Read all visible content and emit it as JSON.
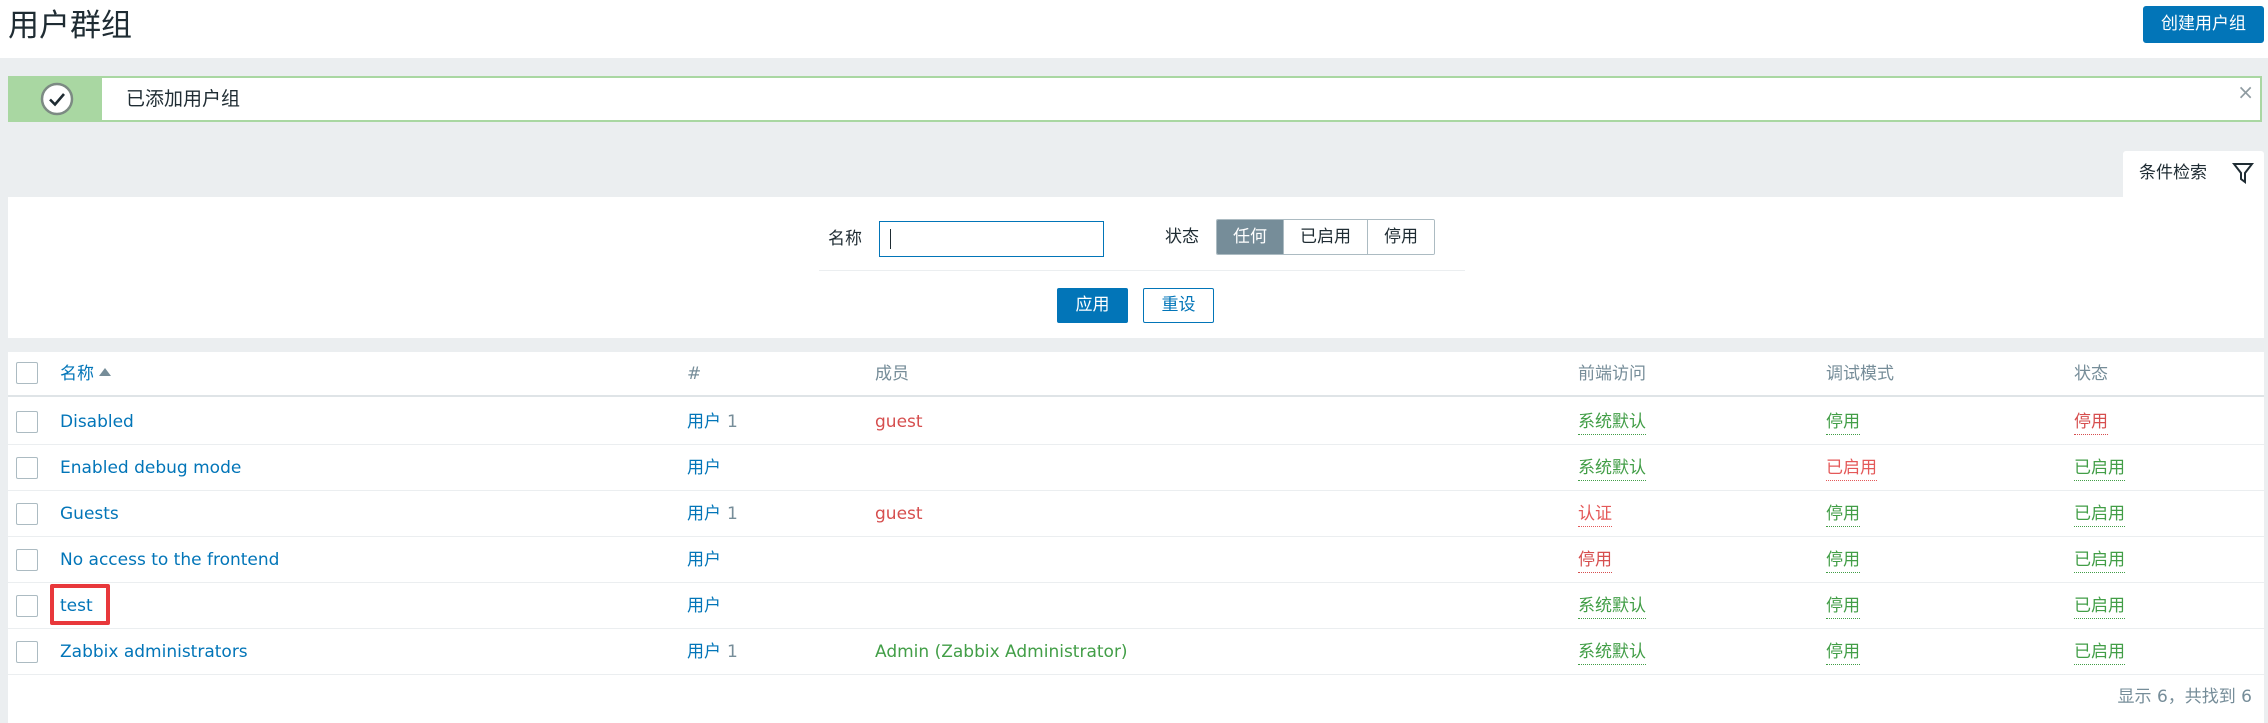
{
  "header": {
    "title": "用户群组",
    "create_button": "创建用户组"
  },
  "alert": {
    "message": "已添加用户组",
    "icon": "check-circle-icon",
    "close": "×"
  },
  "filter": {
    "tab_label": "条件检索",
    "name_label": "名称",
    "name_value": "",
    "status_label": "状态",
    "status_options": [
      "任何",
      "已启用",
      "停用"
    ],
    "status_selected": "任何",
    "apply_label": "应用",
    "reset_label": "重设"
  },
  "table": {
    "headers": {
      "name": "名称",
      "count": "#",
      "members": "成员",
      "frontend": "前端访问",
      "debug": "调试模式",
      "status": "状态"
    },
    "rows": [
      {
        "name": "Disabled",
        "users_label": "用户",
        "users_count": "1",
        "members": "guest",
        "frontend": "系统默认",
        "debug": "停用",
        "status": "停用"
      },
      {
        "name": "Enabled debug mode",
        "users_label": "用户",
        "users_count": "",
        "members": "",
        "frontend": "系统默认",
        "debug": "已启用",
        "status": "已启用"
      },
      {
        "name": "Guests",
        "users_label": "用户",
        "users_count": "1",
        "members": "guest",
        "frontend": "认证",
        "debug": "停用",
        "status": "已启用"
      },
      {
        "name": "No access to the frontend",
        "users_label": "用户",
        "users_count": "",
        "members": "",
        "frontend": "停用",
        "debug": "停用",
        "status": "已启用"
      },
      {
        "name": "test",
        "users_label": "用户",
        "users_count": "",
        "members": "",
        "frontend": "系统默认",
        "debug": "停用",
        "status": "已启用"
      },
      {
        "name": "Zabbix administrators",
        "users_label": "用户",
        "users_count": "1",
        "members": "Admin (Zabbix Administrator)",
        "frontend": "系统默认",
        "debug": "停用",
        "status": "已启用"
      }
    ],
    "footer": "显示 6，共找到 6"
  },
  "colors": {
    "primary": "#0275b8",
    "success": "#429e47",
    "danger": "#d64e4e",
    "highlight": "#e8383b"
  }
}
